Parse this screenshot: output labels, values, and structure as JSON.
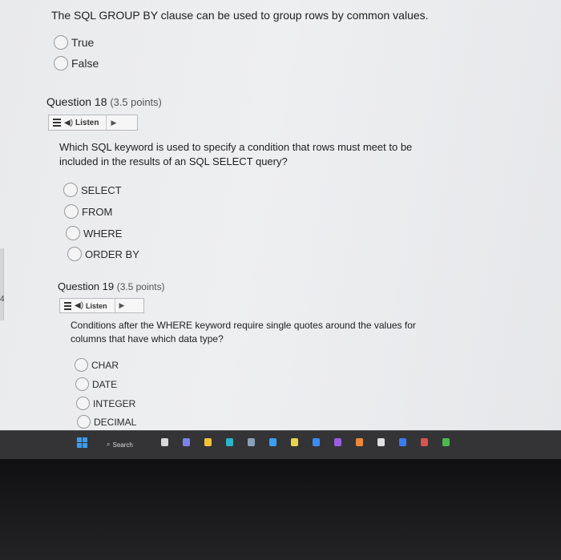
{
  "question17": {
    "prompt": "The SQL GROUP BY clause can be used to group rows by common values.",
    "options": [
      "True",
      "False"
    ]
  },
  "question18": {
    "title": "Question 18",
    "points": "(3.5 points)",
    "listen_label": "Listen",
    "prompt_line1": "Which SQL keyword is used to specify a condition that rows must meet to be",
    "prompt_line2": "included in the results of an SQL SELECT query?",
    "options": [
      "SELECT",
      "FROM",
      "WHERE",
      "ORDER BY"
    ]
  },
  "question19": {
    "title": "Question 19",
    "points": "(3.5 points)",
    "listen_label": "Listen",
    "prompt_line1": "Conditions after the WHERE keyword require single quotes around the values for",
    "prompt_line2": "columns that have which data type?",
    "options": [
      "CHAR",
      "DATE",
      "INTEGER",
      "DECIMAL"
    ]
  },
  "side_marker": "4",
  "taskbar": {
    "search_label": "Search",
    "icons": [
      {
        "name": "widgets-icon",
        "color": "#d9d9d9"
      },
      {
        "name": "chat-icon",
        "color": "#7b83eb"
      },
      {
        "name": "file-explorer-icon",
        "color": "#f3c33a"
      },
      {
        "name": "edge-icon",
        "color": "#2bb5c9"
      },
      {
        "name": "store-icon",
        "color": "#8aa0b8"
      },
      {
        "name": "settings-icon",
        "color": "#3aa0f0"
      },
      {
        "name": "chrome-icon",
        "color": "#e8d34a"
      },
      {
        "name": "cortana-icon",
        "color": "#3b8df0"
      },
      {
        "name": "vs-icon",
        "color": "#9a5de0"
      },
      {
        "name": "firefox-icon",
        "color": "#f0883a"
      },
      {
        "name": "app-icon-a",
        "color": "#e0e0e0"
      },
      {
        "name": "app-icon-b",
        "color": "#3a7cf0"
      },
      {
        "name": "app-icon-c",
        "color": "#d9534f"
      },
      {
        "name": "app-icon-d",
        "color": "#4cb84c"
      }
    ]
  }
}
